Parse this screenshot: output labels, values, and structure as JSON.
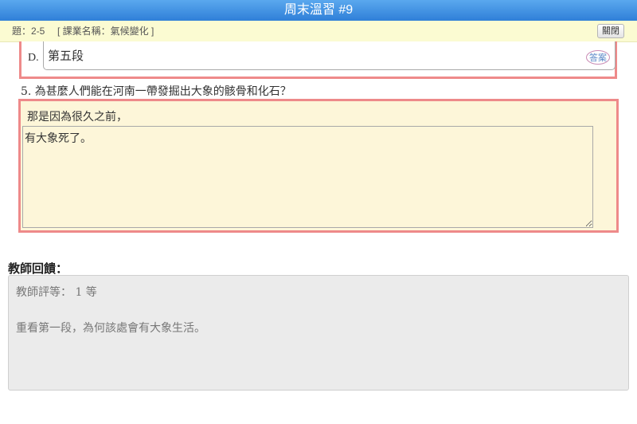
{
  "window": {
    "title": "周末溫習 #9"
  },
  "subbar": {
    "question_range": "題：2-5",
    "course": "[ 課業名稱：氣候變化 ]",
    "close_label": "關閉"
  },
  "option_d": {
    "letter": "D.",
    "value": "第五段",
    "stamp_label": "答案"
  },
  "question5": {
    "text": "5. 為甚麼人們能在河南一帶發掘出大象的骸骨和化石？",
    "answer_lead": "那是因為很久之前，",
    "answer_value": "有大象死了。"
  },
  "feedback": {
    "title": "教師回饋：",
    "grade": "教師評等： 1 等",
    "comment": "重看第一段，為何該處會有大象生活。"
  }
}
